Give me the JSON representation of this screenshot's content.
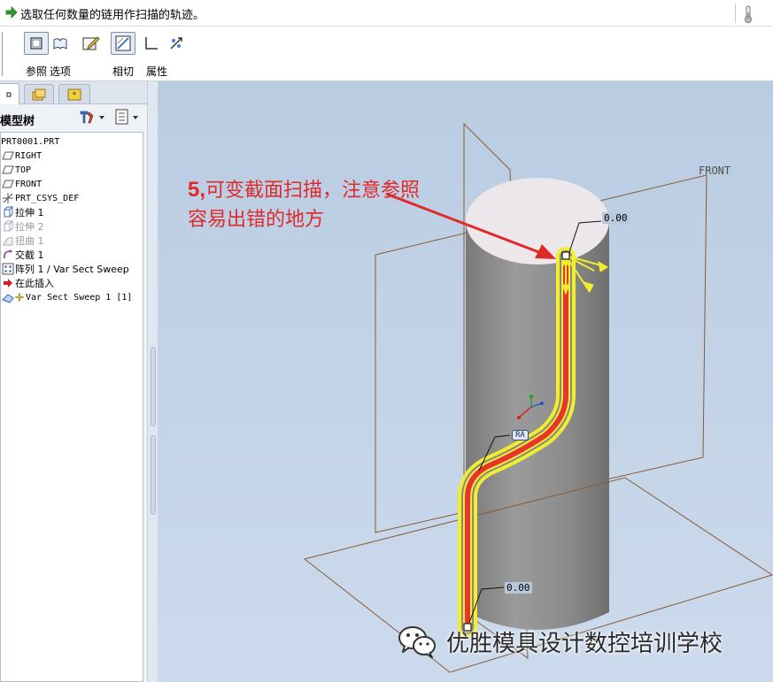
{
  "message": {
    "text": "选取任何数量的链用作扫描的轨迹。"
  },
  "dashboard": {
    "tools": [
      {
        "label": "参照",
        "icon": "reference-icon",
        "pressed": true
      },
      {
        "label": "选项",
        "icon": "options-icon",
        "pressed": false
      },
      {
        "label": "相切",
        "icon": "tangency-icon",
        "pressed": false
      },
      {
        "label": "属性",
        "icon": "properties-icon",
        "pressed": false
      }
    ],
    "extra_icons": [
      "sketcher-icon",
      "section-toggle-icon",
      "corner-icon",
      "remove-material-icon"
    ]
  },
  "model_tree": {
    "title": "模型树",
    "items": [
      {
        "label": "PRT0001.PRT",
        "icon": "part-icon",
        "dim": false
      },
      {
        "label": "RIGHT",
        "icon": "datum-plane-icon",
        "dim": false
      },
      {
        "label": "TOP",
        "icon": "datum-plane-icon",
        "dim": false
      },
      {
        "label": "FRONT",
        "icon": "datum-plane-icon",
        "dim": false
      },
      {
        "label": "PRT_CSYS_DEF",
        "icon": "csys-icon",
        "dim": false
      },
      {
        "label": "拉伸 1",
        "icon": "extrude-icon",
        "dim": false
      },
      {
        "label": "拉伸 2",
        "icon": "extrude-icon",
        "dim": true
      },
      {
        "label": "扭曲 1",
        "icon": "warp-icon",
        "dim": true
      },
      {
        "label": "交截 1",
        "icon": "intersect-icon",
        "dim": false
      },
      {
        "label": "阵列 1 / Var Sect Sweep",
        "icon": "pattern-icon",
        "dim": false
      },
      {
        "label": "在此插入",
        "icon": "insert-here-icon",
        "dim": false
      },
      {
        "label": "Var Sect Sweep 1 [1]",
        "icon": "var-sect-sweep-icon",
        "dim": false
      }
    ]
  },
  "viewport": {
    "annotation_number": "5,",
    "annotation_line1": "可变截面扫描，注意参照",
    "annotation_line2": "容易出错的地方",
    "datum_front_label": "FRONT",
    "dim_top": "0.00",
    "dim_bottom": "0.00",
    "origin_tag": "RA",
    "watermark": "优胜模具设计数控培训学校"
  },
  "colors": {
    "annotation": "#e02a2a",
    "trajectory": "#e8332f",
    "highlight": "#f2ee2e",
    "datum_plane": "#8a5a32",
    "cylinder_body": "#8c8c8c"
  }
}
